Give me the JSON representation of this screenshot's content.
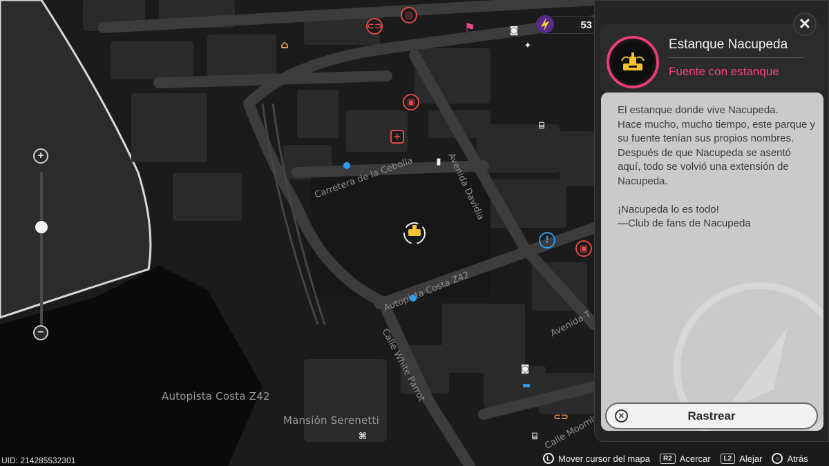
{
  "map": {
    "region_labels": [
      "Autopista Costa Z42",
      "Mansión Serenetti"
    ],
    "street_labels": [
      "Carretera de la Cebolla",
      "Avenida Davidia",
      "Autopista Costa Z42",
      "Calle White Parrot",
      "Avenida T",
      "Calle Moomin"
    ]
  },
  "zoom": {
    "plus": "+",
    "minus": "−",
    "level": 0.36
  },
  "currency": {
    "value": "53",
    "icon": "currency-icon"
  },
  "panel": {
    "close_label": "✕",
    "title": "Estanque Nacupeda",
    "subtitle": "Fuente con estanque",
    "description": "El estanque donde vive Nacupeda.\nHace mucho, mucho tiempo, este parque y su fuente tenían sus propios nombres.\nDespués de que Nacupeda se asentó aquí, todo se volvió una extensión de Nacupeda.\n\n¡Nacupeda lo es todo!\n—Club de fans de Nacupeda",
    "track_button": "Rastrear",
    "accent": "#e83d7a"
  },
  "footer": {
    "uid": "UID: 214285532301",
    "hints": [
      {
        "key": "L",
        "label": "Mover cursor del mapa"
      },
      {
        "key": "R2",
        "label": "Acercar"
      },
      {
        "key": "L2",
        "label": "Alejar"
      },
      {
        "key": "○",
        "label": "Atrás"
      }
    ]
  }
}
